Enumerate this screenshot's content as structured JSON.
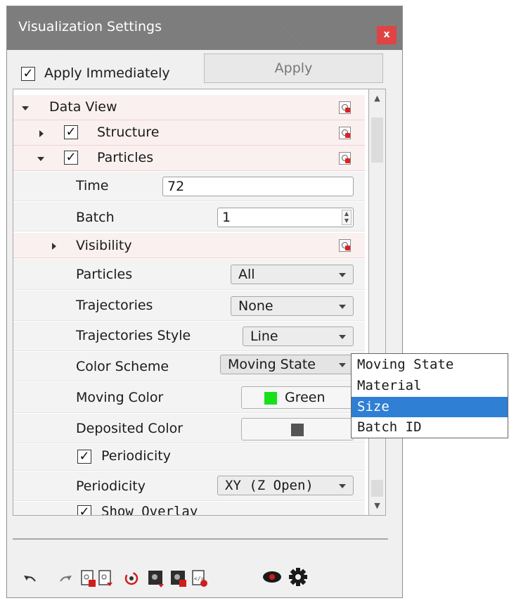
{
  "window": {
    "title": "Visualization Settings",
    "close_label": "x"
  },
  "top": {
    "apply_immediately_label": "Apply Immediately",
    "apply_immediately_checked": true,
    "apply_label": "Apply"
  },
  "check_mark": "✓",
  "tree": {
    "data_view_label": "Data View",
    "structure_label": "Structure",
    "particles_group_label": "Particles",
    "time_label": "Time",
    "time_value": "72",
    "batch_label": "Batch",
    "batch_value": "1",
    "visibility_label": "Visibility",
    "particles_label": "Particles",
    "particles_value": "All",
    "trajectories_label": "Trajectories",
    "trajectories_value": "None",
    "trajectories_style_label": "Trajectories Style",
    "trajectories_style_value": "Line",
    "color_scheme_label": "Color Scheme",
    "color_scheme_value": "Moving State",
    "moving_color_label": "Moving Color",
    "moving_color_value": "Green",
    "moving_color_swatch": "#19e019",
    "deposited_color_label": "Deposited Color",
    "deposited_color_swatch": "#555555",
    "periodicity_check_label": "Periodicity",
    "periodicity_label": "Periodicity",
    "periodicity_value": "XY (Z Open)",
    "show_overlay_label": "Show Overlay"
  },
  "dropdown": {
    "options": [
      "Moving State",
      "Material",
      "Size",
      "Batch ID"
    ],
    "selected": "Size",
    "selected_color": "#2f7fd4"
  },
  "toolbar": {
    "icons": [
      "undo-icon",
      "redo-icon",
      "save-settings-icon",
      "load-settings-icon",
      "refresh-icon",
      "export-image-icon",
      "export-data-icon",
      "script-icon",
      "visibility-eye-icon",
      "settings-gear-icon"
    ]
  }
}
